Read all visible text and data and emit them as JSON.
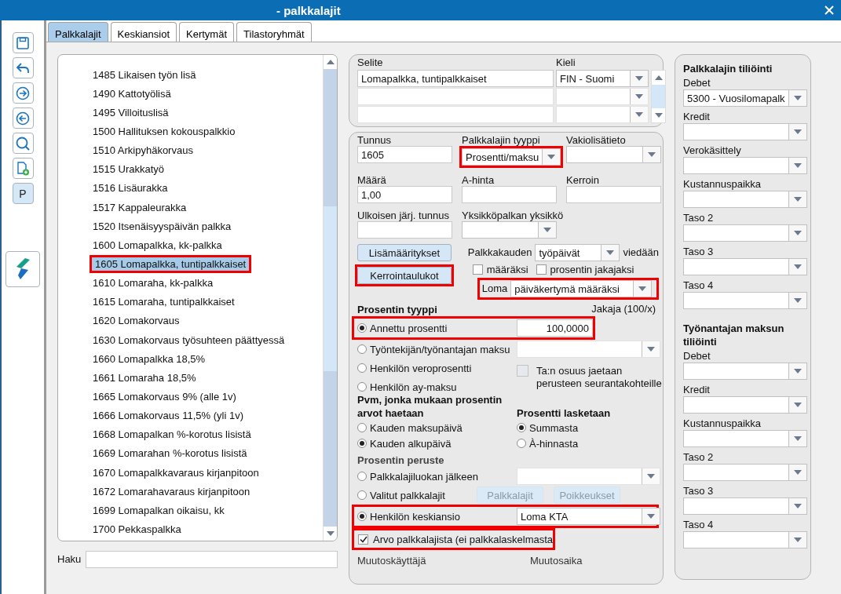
{
  "window": {
    "title": "- palkkalajit"
  },
  "toolbar": [
    {
      "kind": "save"
    },
    {
      "kind": "undo"
    },
    {
      "kind": "forward"
    },
    {
      "kind": "back"
    },
    {
      "kind": "search"
    },
    {
      "kind": "new-document"
    },
    {
      "kind": "text",
      "label": "P"
    }
  ],
  "tabs": [
    {
      "label": "Palkkalajit",
      "selected": true
    },
    {
      "label": "Keskiansiot",
      "selected": false
    },
    {
      "label": "Kertymät",
      "selected": false
    },
    {
      "label": "Tilastoryhmät",
      "selected": false
    }
  ],
  "list": {
    "items": [
      {
        "label": "1485 Likaisen työn lisä",
        "selected": false,
        "highlighted": false
      },
      {
        "label": "1490 Kattotyölisä",
        "selected": false,
        "highlighted": false
      },
      {
        "label": "1495 Villoituslisä",
        "selected": false,
        "highlighted": false
      },
      {
        "label": "1500 Hallituksen kokouspalkkio",
        "selected": false,
        "highlighted": false
      },
      {
        "label": "1510 Arkipyhäkorvaus",
        "selected": false,
        "highlighted": false
      },
      {
        "label": "1515 Urakkatyö",
        "selected": false,
        "highlighted": false
      },
      {
        "label": "1516 Lisäurakka",
        "selected": false,
        "highlighted": false
      },
      {
        "label": "1517 Kappaleurakka",
        "selected": false,
        "highlighted": false
      },
      {
        "label": "1520 Itsenäisyyspäivän palkka",
        "selected": false,
        "highlighted": false
      },
      {
        "label": "1600 Lomapalkka, kk-palkka",
        "selected": false,
        "highlighted": false
      },
      {
        "label": "1605 Lomapalkka, tuntipalkkaiset",
        "selected": true,
        "highlighted": true
      },
      {
        "label": "1610 Lomaraha, kk-palkka",
        "selected": false,
        "highlighted": false
      },
      {
        "label": "1615 Lomaraha, tuntipalkkaiset",
        "selected": false,
        "highlighted": false
      },
      {
        "label": "1620 Lomakorvaus",
        "selected": false,
        "highlighted": false
      },
      {
        "label": "1630 Lomakorvaus työsuhteen päättyessä",
        "selected": false,
        "highlighted": false
      },
      {
        "label": "1660 Lomapalkka 18,5%",
        "selected": false,
        "highlighted": false
      },
      {
        "label": "1661 Lomaraha 18,5%",
        "selected": false,
        "highlighted": false
      },
      {
        "label": "1665 Lomakorvaus 9% (alle 1v)",
        "selected": false,
        "highlighted": false
      },
      {
        "label": "1666 Lomakorvaus 11,5% (yli 1v)",
        "selected": false,
        "highlighted": false
      },
      {
        "label": "1668 Lomapalkan %-korotus lisistä",
        "selected": false,
        "highlighted": false
      },
      {
        "label": "1669 Lomarahan %-korotus lisistä",
        "selected": false,
        "highlighted": false
      },
      {
        "label": "1670 Lomapalkkavaraus kirjanpitoon",
        "selected": false,
        "highlighted": false
      },
      {
        "label": "1672 Lomarahavaraus kirjanpitoon",
        "selected": false,
        "highlighted": false
      },
      {
        "label": "1699 Lomapalkan oikaisu, kk",
        "selected": false,
        "highlighted": false
      },
      {
        "label": "1700 Pekkaspalkka",
        "selected": false,
        "highlighted": false
      }
    ],
    "search_label": "Haku"
  },
  "descriptions": {
    "columns": [
      "Selite",
      "Kieli"
    ],
    "rows": [
      {
        "text": "Lomapalkka, tuntipalkkaiset",
        "language": "FIN - Suomi",
        "disabled": false
      },
      {
        "disabled": true
      },
      {
        "disabled": true
      }
    ]
  },
  "details": {
    "fields": [
      {
        "label": "Tunnus",
        "value": "1605",
        "kind": "input",
        "highlighted": false
      },
      {
        "label": "Palkkalajin tyyppi",
        "value": "Prosentti/maksu",
        "kind": "combo",
        "highlighted": true
      },
      {
        "label": "Vakiolisätieto",
        "kind": "combo",
        "highlighted": false
      },
      {
        "label": "Määrä",
        "value": "1,00",
        "kind": "input",
        "highlighted": false
      },
      {
        "label": "A-hinta",
        "kind": "input",
        "highlighted": false
      },
      {
        "label": "Kerroin",
        "kind": "input",
        "highlighted": false
      },
      {
        "label": "Ulkoisen järj. tunnus",
        "kind": "input",
        "highlighted": false
      },
      {
        "label": "Yksikköpalkan yksikkö",
        "kind": "combo",
        "highlighted": false
      }
    ],
    "buttons": [
      {
        "label": "Lisämääritykset",
        "highlighted": false
      },
      {
        "label": "Kerrointaulukot",
        "highlighted": true
      }
    ],
    "period": {
      "label": "Palkkakauden",
      "value": "työpäivät",
      "suffix": "viedään",
      "checks": [
        {
          "label": "määräksi",
          "checked": false
        },
        {
          "label": "prosentin jakajaksi",
          "checked": false
        }
      ]
    },
    "loma": {
      "label": "Loma",
      "value": "päiväkertymä määräksi",
      "highlighted": true
    },
    "percent_type": {
      "title": "Prosentin tyyppi",
      "divisor_label": "Jakaja (100/x)",
      "options": [
        {
          "label": "Annettu prosentti",
          "selected": true,
          "kind": "input",
          "value": "100,0000",
          "highlighted": true
        },
        {
          "label": "Työntekijän/työnantajan maksu",
          "selected": false,
          "kind": "combo",
          "disabled": true,
          "highlighted": false
        },
        {
          "label": "Henkilön veroprosentti",
          "selected": false,
          "kind": "none",
          "highlighted": false
        },
        {
          "label": "Henkilön ay-maksu",
          "selected": false,
          "kind": "none",
          "highlighted": false
        }
      ],
      "share_check": {
        "label": "Ta:n osuus jaetaan perusteen seurantakohteille",
        "checked": false,
        "disabled": true
      }
    },
    "date_basis": {
      "title": "Pvm, jonka mukaan prosentin arvot haetaan",
      "options": [
        {
          "label": "Kauden maksupäivä",
          "selected": false
        },
        {
          "label": "Kauden alkupäivä",
          "selected": true
        }
      ]
    },
    "calc_basis": {
      "title": "Prosentti lasketaan",
      "options": [
        {
          "label": "Summasta",
          "selected": true
        },
        {
          "label": "À-hinnasta",
          "selected": false
        }
      ]
    },
    "basis": {
      "title": "Prosentin peruste",
      "options": [
        {
          "label": "Palkkalajiluokan jälkeen",
          "selected": false,
          "kind": "combo",
          "disabled": true,
          "highlighted": false
        },
        {
          "label": "Valitut palkkalajit",
          "selected": false,
          "kind": "buttons",
          "buttons": [
            {
              "label": "Palkkalajit",
              "disabled": true
            },
            {
              "label": "Poikkeukset",
              "disabled": true
            }
          ],
          "highlighted": false
        },
        {
          "label": "Henkilön keskiansio",
          "selected": true,
          "kind": "combo",
          "value": "Loma KTA",
          "disabled": false,
          "highlighted": true
        }
      ]
    },
    "value_check": {
      "label": "Arvo palkkalajista (ei palkkalaskelmasta",
      "checked": true,
      "highlighted": true
    },
    "audit": [
      "Muutoskäyttäjä",
      "Muutosaika"
    ]
  },
  "accounting": [
    {
      "title": "Palkkalajin tiliöinti",
      "fields": [
        {
          "label": "Debet",
          "value": "5300 - Vuosilomapalk"
        },
        {
          "label": "Kredit"
        },
        {
          "label": "Verokäsittely"
        },
        {
          "label": "Kustannuspaikka"
        },
        {
          "label": "Taso 2"
        },
        {
          "label": "Taso 3"
        },
        {
          "label": "Taso 4"
        }
      ]
    },
    {
      "title": "Työnantajan maksun tiliöinti",
      "fields": [
        {
          "label": "Debet"
        },
        {
          "label": "Kredit"
        },
        {
          "label": "Kustannuspaikka"
        },
        {
          "label": "Taso 2"
        },
        {
          "label": "Taso 3"
        },
        {
          "label": "Taso 4"
        }
      ]
    }
  ]
}
